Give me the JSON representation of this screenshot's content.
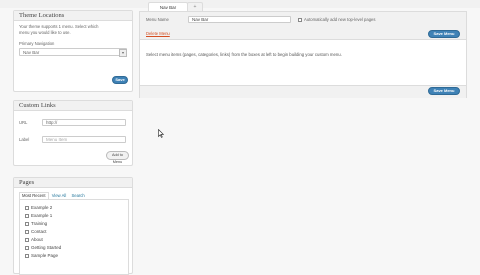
{
  "tabs": [
    {
      "label": "Nav Bar"
    },
    {
      "label": "+"
    }
  ],
  "theme_locations": {
    "title": "Theme Locations",
    "description_line1": "Your theme supports 1 menu. Select which",
    "description_line2": "menu you would like to use.",
    "location_label": "Primary Navigation",
    "selected_menu": "Nav Bar",
    "save_label": "Save"
  },
  "custom_links": {
    "title": "Custom Links",
    "url_label": "URL",
    "url_value": "http://",
    "label_label": "Label",
    "label_placeholder": "Menu Item",
    "add_button": "Add to Menu"
  },
  "pages": {
    "title": "Pages",
    "tabs": [
      "Most Recent",
      "View All",
      "Search"
    ],
    "items": [
      "Example 2",
      "Example 1",
      "Training",
      "Contact",
      "About",
      "Getting Started",
      "Sample Page"
    ]
  },
  "menu_editor": {
    "menu_name_label": "Menu Name",
    "menu_name_value": "Nav Bar",
    "auto_add_label": "Automatically add new top-level pages",
    "delete_label": "Delete Menu",
    "save_menu_label": "Save Menu",
    "instructions": "Select menu items (pages, categories, links) from the boxes at left to begin building your custom menu.",
    "save_menu_label_bottom": "Save Menu"
  },
  "colors": {
    "accent": "#3f82b6",
    "delete": "#d54e21"
  }
}
